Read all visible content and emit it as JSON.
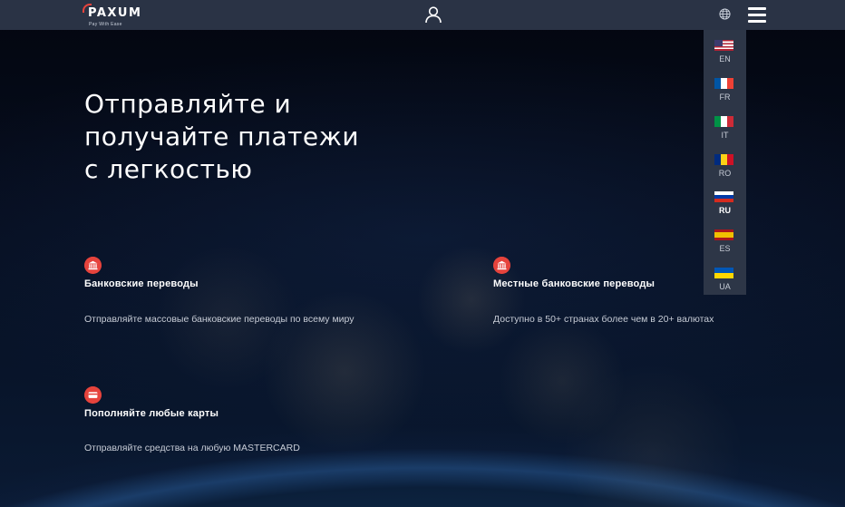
{
  "header": {
    "logo_text": "PAXUM",
    "logo_tagline": "Pay With Ease",
    "user_icon": "user-icon",
    "globe_icon": "globe-icon",
    "menu_icon": "hamburger-menu-icon"
  },
  "languages": [
    {
      "code": "EN",
      "flag": "flag-us"
    },
    {
      "code": "FR",
      "flag": "flag-fr"
    },
    {
      "code": "IT",
      "flag": "flag-it"
    },
    {
      "code": "RO",
      "flag": "flag-ro"
    },
    {
      "code": "RU",
      "flag": "flag-ru",
      "active": true
    },
    {
      "code": "ES",
      "flag": "flag-es"
    },
    {
      "code": "UA",
      "flag": "flag-ua"
    }
  ],
  "hero": {
    "title": "Отправляйте и получайте платежи с легкостью"
  },
  "features": [
    {
      "icon": "bank-icon",
      "title": "Банковские переводы",
      "description": "Отправляйте массовые банковские переводы по всему миру"
    },
    {
      "icon": "bank-icon",
      "title": "Местные банковские переводы",
      "description": "Доступно в 50+ странах более чем в 20+ валютах"
    },
    {
      "icon": "card-icon",
      "title": "Пополняйте любые карты",
      "description": "Отправляйте средства на любую MASTERCARD"
    }
  ],
  "colors": {
    "accent": "#e6433c",
    "header_bg": "#2a3345",
    "menu_bg": "#2d3647"
  }
}
